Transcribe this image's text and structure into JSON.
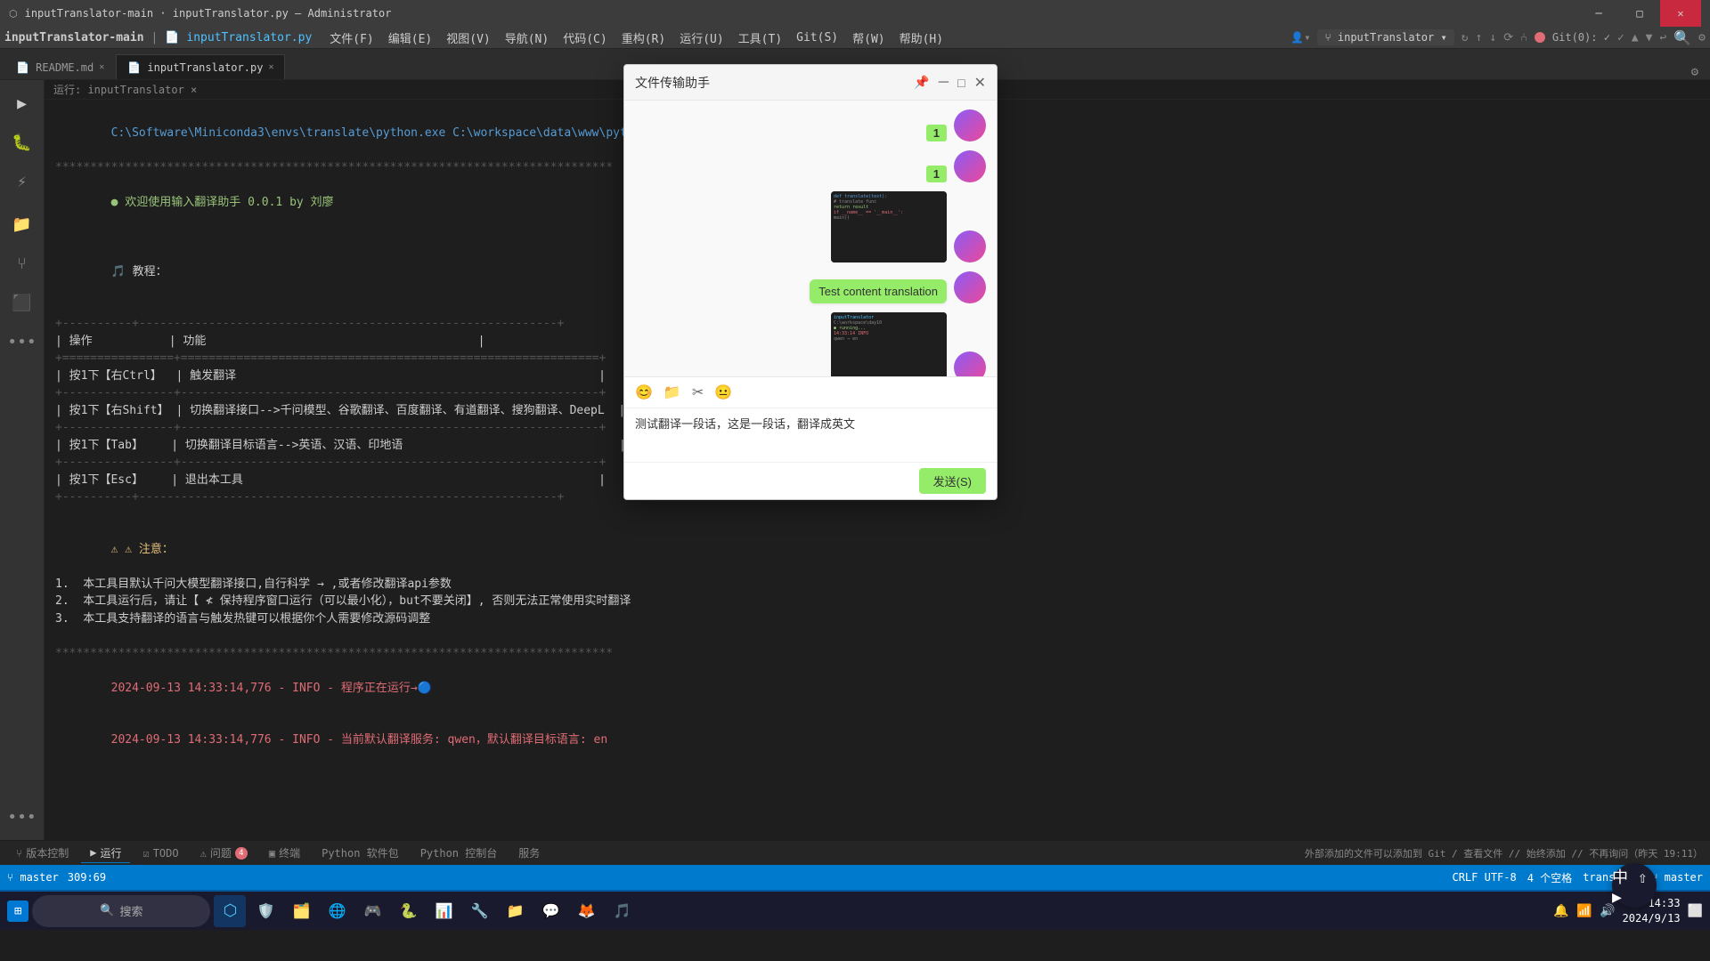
{
  "window": {
    "title": "inputTranslator-main · inputTranslator.py — Administrator",
    "titlebar": "inputTranslator-main · inputTranslator.py — Administrator"
  },
  "menubar": {
    "items": [
      "文件(F)",
      "编辑(E)",
      "视图(V)",
      "导航(N)",
      "代码(C)",
      "重构(R)",
      "运行(U)",
      "工具(T)",
      "Git(S)",
      "帮(W)",
      "帮助(H)"
    ]
  },
  "toolbar": {
    "branch": "inputTranslator",
    "git_status": "Git(0): ✓"
  },
  "tabs": [
    {
      "label": "README.md",
      "active": false
    },
    {
      "label": "inputTranslator.py",
      "active": true
    }
  ],
  "breadcrumb": {
    "path": "运行: inputTranslator ×"
  },
  "terminal": {
    "python_cmd": "C:\\Software\\Miniconda3\\envs\\translate\\python.exe C:\\workspace\\data\\www\\python\\learn\\day10\\examine\\inputT",
    "separator_line": "********************************************************************************",
    "welcome_msg": "● 欢迎使用输入翻译助手 0.0.1 by 刘廖",
    "tutorial_header": "教程：",
    "separator2": "+----------+----------+",
    "header1": "| 操作           | 功能                                       |",
    "sep3": "+================+============================================================+",
    "row1": "| 按1下【右Ctrl】  | 触发翻译                                   |",
    "sep4": "+----------------+------------------------------------------------------------+",
    "row2": "| 按1下【右Shift】 | 切换翻译接口-->千问模型、谷歌翻译、百度翻译、有道翻译、搜狗翻译、DeepL |",
    "sep5": "+----------------+------------------------------------------------------------+",
    "row3": "| 按1下【Tab】    | 切换翻译目标语言-->英语、汉语、印地语              |",
    "sep6": "+----------------+------------------------------------------------------------+",
    "row4": "| 按1下【Esc】    | 退出本工具                                 |",
    "sep7": "+----------+----------+",
    "notice_header": "⚠ 注意：",
    "notice1": "1.  本工具目默认千问大模型翻译接口,自行科学 → ,或者修改翻译api参数",
    "notice2": "2.  本工具运行后，请让【 ≮ 保持程序窗口运行（可以最小化），but不要关闭】, 否则无法正常使用实时翻译",
    "notice3": "3.  本工具支持翻译的语言与触发热键可以根据你个人需要修改源码调整",
    "sep8": "********************************************************************************",
    "log1": "2024-09-13 14:33:14,776 - INFO - 程序正在运行→🔵",
    "log2": "2024-09-13 14:33:14,776 - INFO - 当前默认翻译服务: qwen，默认翻译目标语言: en"
  },
  "dialog": {
    "title": "文件传输助手",
    "pin_icon": "📌",
    "badge1": "1",
    "badge2": "1",
    "text_bubble": "Test content translation",
    "input_text": "测试翻译一段话，这是一段话，翻译成英文",
    "send_button": "发送(S)",
    "toolbar_icons": [
      "😊",
      "📁",
      "✂",
      "😐"
    ]
  },
  "bottom_tabs": [
    {
      "label": "版本控制",
      "active": false,
      "icon": "⑂"
    },
    {
      "label": "运行",
      "active": true,
      "icon": "▶"
    },
    {
      "label": "TODO",
      "active": false,
      "icon": "☑"
    },
    {
      "label": "问题",
      "active": false,
      "icon": "⚠",
      "badge": "4"
    },
    {
      "label": "终端",
      "active": false,
      "icon": "▣"
    },
    {
      "label": "Python 软件包",
      "active": false
    },
    {
      "label": "Python 控制台",
      "active": false
    },
    {
      "label": "服务",
      "active": false
    }
  ],
  "status_bar": {
    "git_branch": "⑂ master",
    "position": "309:69",
    "encoding": "CRLF  UTF-8",
    "spaces": "4 个空格",
    "mode": "translate",
    "branch2": "⑂ master",
    "bottom_info": "外部添加的文件可以添加到 Git / 查看文件 // 始终添加 // 不再询问（昨天 19:11）"
  },
  "taskbar": {
    "time": "14:33",
    "date": "2024/9/13",
    "search_placeholder": "搜索",
    "corner_icons": [
      "中",
      "⇧",
      "▶"
    ]
  }
}
